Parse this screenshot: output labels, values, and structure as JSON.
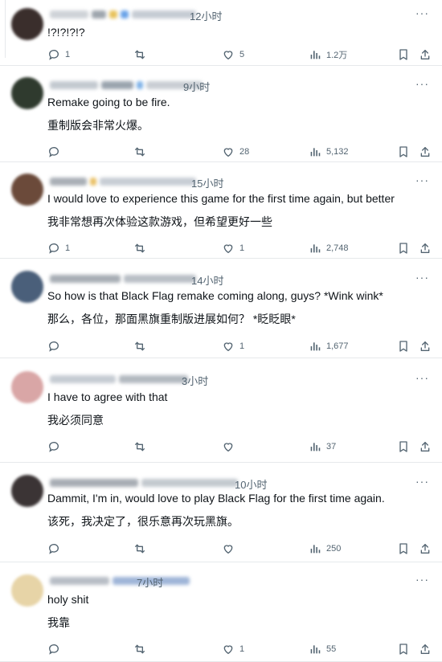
{
  "posts": [
    {
      "time": "12小时",
      "line1": "!?!?!?!?",
      "line2": "",
      "reply": "1",
      "repost": "",
      "like": "5",
      "views": "1.2万",
      "avatar_color": "#3a2e2c",
      "name_colors": [
        "#cfd3d8",
        "#9ea5ad",
        "#e7c25c",
        "#6aa3e8",
        "#c6ccd4"
      ]
    },
    {
      "time": "9小时",
      "line1": "Remake going to be fire.",
      "line2": "重制版会非常火爆。",
      "reply": "",
      "repost": "",
      "like": "28",
      "views": "5,132",
      "avatar_color": "#2f3a2e",
      "name_colors": [
        "#c3c9d0",
        "#9aa4ae",
        "#7fb2e8",
        "#c9ced4"
      ]
    },
    {
      "time": "15小时",
      "line1": "I would love to experience  this game for the first time again, but better",
      "line2": "我非常想再次体验这款游戏，但希望更好一些",
      "reply": "1",
      "repost": "",
      "like": "1",
      "views": "2,748",
      "avatar_color": "#6b4a3a",
      "name_colors": [
        "#a9afb6",
        "#e9c066",
        "#c8ced5"
      ]
    },
    {
      "time": "14小时",
      "line1": "So how is that Black Flag remake coming along, guys? *Wink wink*",
      "line2": "那么，各位，那面黑旗重制版进展如何？ *眨眨眼*",
      "reply": "",
      "repost": "",
      "like": "1",
      "views": "1,677",
      "avatar_color": "#4a5f7a",
      "name_colors": [
        "#a8aeb5",
        "#b9bfc6"
      ]
    },
    {
      "time": "3小时",
      "line1": "I have to agree with that",
      "line2": "我必须同意",
      "reply": "",
      "repost": "",
      "like": "",
      "views": "37",
      "avatar_color": "#d9a6a6",
      "name_colors": [
        "#c6ccd3",
        "#b3b9c0"
      ]
    },
    {
      "time": "10小时",
      "line1": "Dammit, I'm in, would love to play Black Flag for the first time again.",
      "line2": "该死，我决定了，很乐意再次玩黑旗。",
      "reply": "",
      "repost": "",
      "like": "",
      "views": "250",
      "avatar_color": "#3b3435",
      "name_colors": [
        "#a7adb4",
        "#c3c9cf"
      ]
    },
    {
      "time": "7小时",
      "line1": "holy shit",
      "line2": "我靠",
      "reply": "",
      "repost": "",
      "like": "1",
      "views": "55",
      "avatar_color": "#e7d4a7",
      "name_colors": [
        "#b8bec6",
        "#9fb5d8"
      ]
    }
  ],
  "icons": {
    "reply": "reply-icon",
    "repost": "repost-icon",
    "like": "like-icon",
    "views": "views-icon",
    "bookmark": "bookmark-icon",
    "share": "share-icon",
    "more": "more-icon"
  },
  "more_label": "···"
}
